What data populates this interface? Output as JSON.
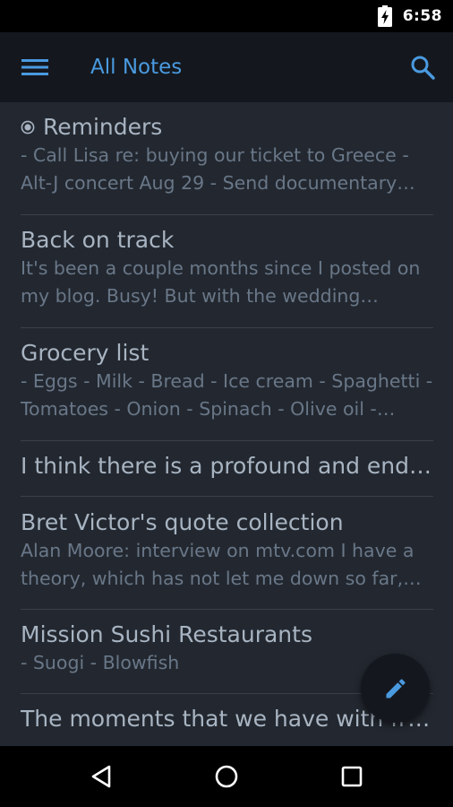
{
  "status_bar": {
    "time": "6:58",
    "battery_icon": "battery-charging-icon"
  },
  "app_bar": {
    "title": "All Notes",
    "menu_icon": "hamburger-menu-icon",
    "search_icon": "search-icon",
    "accent_color": "#4a9ae0"
  },
  "notes": [
    {
      "title": "Reminders",
      "pinned": true,
      "body": "- Call Lisa re: buying our ticket to Greece - Alt-J concert Aug 29 - Send documentary edits"
    },
    {
      "title": "Back on track",
      "pinned": false,
      "body": "It's been a couple months since I posted on my blog. Busy! But with the wedding planning"
    },
    {
      "title": "Grocery list",
      "pinned": false,
      "body": "- Eggs - Milk - Bread - Ice cream - Spaghetti - Tomatoes - Onion - Spinach - Olive oil - Garlic"
    },
    {
      "title": "I think there is a profound and enduring beauty in simplicity",
      "pinned": false,
      "body": ""
    },
    {
      "title": "Bret Victor's quote collection",
      "pinned": false,
      "body": "Alan Moore: interview on mtv.com I have a theory, which has not let me down so far, that"
    },
    {
      "title": "Mission Sushi Restaurants",
      "pinned": false,
      "body": "- Suogi - Blowfish"
    },
    {
      "title": "The moments that we have with friends",
      "pinned": false,
      "body": ""
    }
  ],
  "fab": {
    "icon": "pencil-icon",
    "color": "#4a9ae0"
  },
  "nav_bar": {
    "back_icon": "back-triangle-icon",
    "home_icon": "home-circle-icon",
    "recents_icon": "recents-square-icon"
  }
}
